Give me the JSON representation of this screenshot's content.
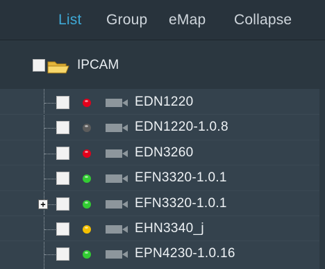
{
  "tabs": [
    {
      "label": "List",
      "active": true
    },
    {
      "label": "Group",
      "active": false
    },
    {
      "label": "eMap",
      "active": false
    },
    {
      "label": "Collapse",
      "active": false
    }
  ],
  "root": {
    "label": "IPCAM",
    "icon": "folder-icon"
  },
  "status_colors": {
    "red": "#e3001b",
    "gray": "#5c5c5c",
    "green": "#33cc33",
    "yellow": "#f5c000"
  },
  "devices": [
    {
      "label": "EDN1220",
      "status": "red"
    },
    {
      "label": "EDN1220-1.0.8",
      "status": "gray"
    },
    {
      "label": "EDN3260",
      "status": "red"
    },
    {
      "label": "EFN3320-1.0.1",
      "status": "green"
    },
    {
      "label": "EFN3320-1.0.1",
      "status": "green",
      "expand": "+"
    },
    {
      "label": "EHN3340_j",
      "status": "yellow"
    },
    {
      "label": "EPN4230-1.0.16",
      "status": "green"
    }
  ]
}
